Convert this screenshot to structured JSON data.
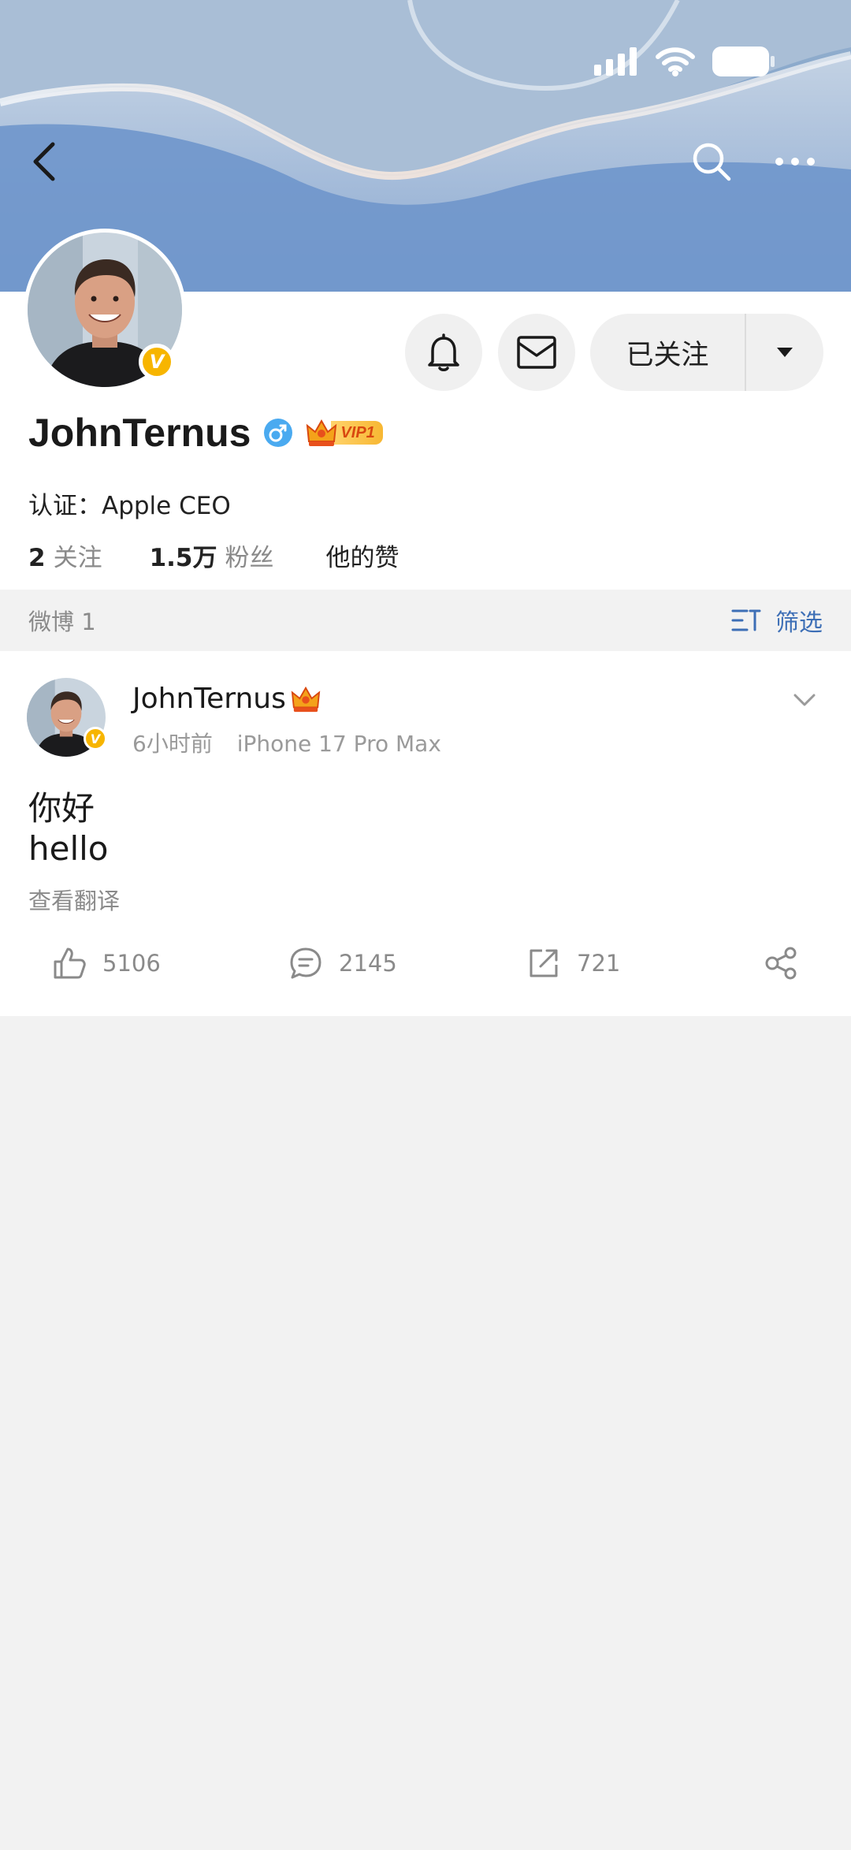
{
  "header": {
    "back_icon": "chevron-left-icon",
    "search_icon": "search-icon",
    "more_icon": "more-horizontal-icon"
  },
  "status_bar": {
    "icons": [
      "signal-icon",
      "wifi-icon",
      "battery-icon"
    ]
  },
  "profile": {
    "name": "JohnTernus",
    "gender_icon": "male-icon",
    "vip_label": "VIP1",
    "verification": "认证：Apple CEO",
    "stats": [
      {
        "value": "2",
        "label": "关注"
      },
      {
        "value": "1.5万",
        "label": "粉丝"
      },
      {
        "value": "",
        "label": "他的赞"
      }
    ],
    "badge_letter": "V",
    "actions": {
      "bell_icon": "bell-icon",
      "message_icon": "mail-icon",
      "follow_label": "已关注",
      "dropdown_icon": "caret-down-icon"
    }
  },
  "filterbar": {
    "count_label": "微博 1",
    "filter_label": "筛选"
  },
  "post": {
    "author": "JohnTernus",
    "time": "6小时前",
    "device": "iPhone 17 Pro Max",
    "lines": [
      "你好",
      "hello"
    ],
    "translate_label": "查看翻译",
    "likes": "5106",
    "comments": "2145",
    "reposts": "721"
  },
  "colors": {
    "accent_blue": "#3d6fb6",
    "badge_yellow": "#f7b500",
    "vip_orange": "#e8501c",
    "background": "#f2f2f2"
  }
}
